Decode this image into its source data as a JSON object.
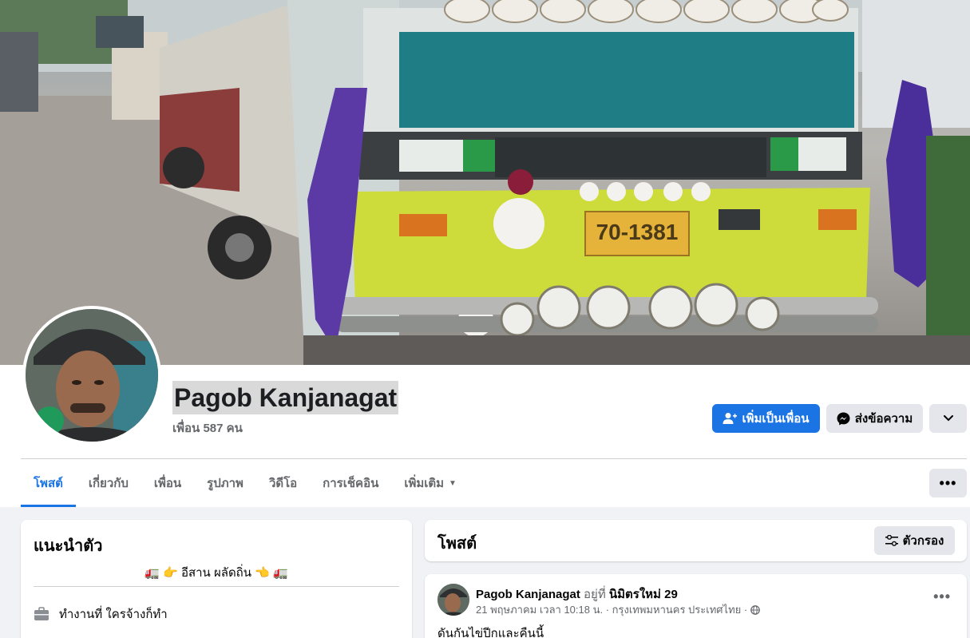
{
  "profile": {
    "name": "Pagob Kanjanagat",
    "friends": "เพื่อน 587 คน"
  },
  "actions": {
    "add_friend": "เพิ่มเป็นเพื่อน",
    "message": "ส่งข้อความ"
  },
  "tabs": [
    {
      "label": "โพสต์",
      "active": true
    },
    {
      "label": "เกี่ยวกับ",
      "active": false
    },
    {
      "label": "เพื่อน",
      "active": false
    },
    {
      "label": "รูปภาพ",
      "active": false
    },
    {
      "label": "วิดีโอ",
      "active": false
    },
    {
      "label": "การเช็คอิน",
      "active": false
    },
    {
      "label": "เพิ่มเติม",
      "active": false
    }
  ],
  "intro": {
    "title": "แนะนำตัว",
    "bio": "🚛 👉 อีสาน ผลัดถิ่น 👈 🚛",
    "work": "ทำงานที่ ใครจ้างก็ทำ"
  },
  "posts": {
    "title": "โพสต์",
    "filter_label": "ตัวกรอง"
  },
  "post": {
    "author": "Pagob Kanjanagat",
    "at": "อยู่ที่",
    "place": "นิมิตรใหม่ 29",
    "meta": "21 พฤษภาคม เวลา 10:18 น. · กรุงเทพมหานคร ประเทศไทย ·",
    "text": "ดันกันไข่ปีกและคืนนี้"
  },
  "colors": {
    "primary": "#1b74e4",
    "secondary_bg": "#e4e6eb",
    "page_bg": "#f0f2f5",
    "muted_text": "#65676b"
  },
  "cover": {
    "plate_text": "70-1381"
  }
}
